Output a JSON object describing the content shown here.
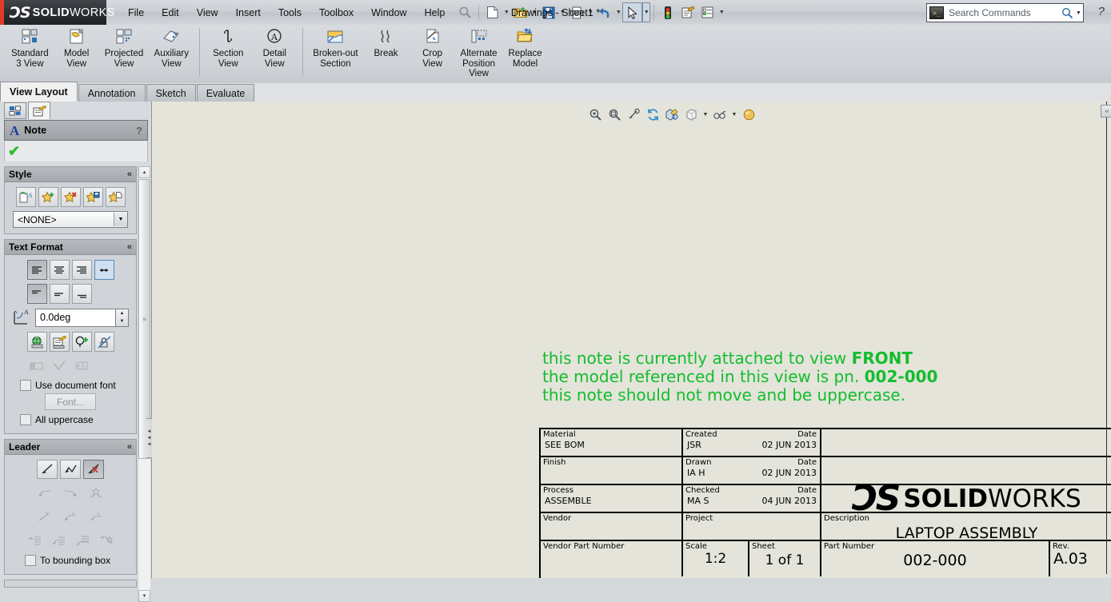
{
  "app": {
    "brand_ds": "ƆS",
    "brand_solid": "SOLID",
    "brand_works": "WORKS",
    "document_title": "Drawings - Sheet1 *",
    "help_glyph": "?"
  },
  "menubar": {
    "items": [
      "File",
      "Edit",
      "View",
      "Insert",
      "Tools",
      "Toolbox",
      "Window",
      "Help"
    ]
  },
  "quick_toolbar": {
    "items": [
      {
        "name": "swift-search-icon",
        "glyph": "⌕"
      },
      {
        "name": "new-document-icon",
        "glyph": ""
      },
      {
        "name": "open-document-icon",
        "glyph": ""
      },
      {
        "name": "save-icon",
        "glyph": ""
      },
      {
        "name": "print-icon",
        "glyph": ""
      },
      {
        "name": "undo-icon",
        "glyph": ""
      },
      {
        "name": "select-arrow-icon",
        "glyph": ""
      },
      {
        "name": "rebuild-traffic-light-icon",
        "glyph": ""
      },
      {
        "name": "file-properties-icon",
        "glyph": ""
      },
      {
        "name": "options-icon",
        "glyph": ""
      }
    ]
  },
  "search": {
    "placeholder": "Search Commands",
    "icon": "command-prompt-icon"
  },
  "ribbon": {
    "groups": [
      {
        "commands": [
          {
            "label_line1": "Standard",
            "label_line2": "3 View",
            "icon": "standard-3-view-icon"
          },
          {
            "label_line1": "Model",
            "label_line2": "View",
            "icon": "model-view-icon"
          },
          {
            "label_line1": "Projected",
            "label_line2": "View",
            "icon": "projected-view-icon"
          },
          {
            "label_line1": "Auxiliary",
            "label_line2": "View",
            "icon": "auxiliary-view-icon"
          }
        ]
      },
      {
        "commands": [
          {
            "label_line1": "Section",
            "label_line2": "View",
            "icon": "section-view-icon"
          },
          {
            "label_line1": "Detail",
            "label_line2": "View",
            "icon": "detail-view-icon"
          }
        ]
      },
      {
        "commands": [
          {
            "label_line1": "Broken-out",
            "label_line2": "Section",
            "icon": "broken-out-section-icon"
          },
          {
            "label_line1": "Break",
            "label_line2": "",
            "icon": "break-icon"
          },
          {
            "label_line1": "Crop",
            "label_line2": "View",
            "icon": "crop-view-icon"
          },
          {
            "label_line1": "Alternate",
            "label_line2": "Position",
            "label_line3": "View",
            "icon": "alternate-position-view-icon"
          },
          {
            "label_line1": "Replace",
            "label_line2": "Model",
            "icon": "replace-model-icon"
          }
        ]
      }
    ]
  },
  "tabs": [
    {
      "label": "View Layout",
      "active": true
    },
    {
      "label": "Annotation",
      "active": false
    },
    {
      "label": "Sketch",
      "active": false
    },
    {
      "label": "Evaluate",
      "active": false
    }
  ],
  "property_manager": {
    "tabs": [
      {
        "name": "feature-manager-tab",
        "active": false
      },
      {
        "name": "property-manager-tab",
        "active": true
      }
    ],
    "header": {
      "icon": "note-A-icon",
      "title": "Note",
      "help": "?"
    },
    "ok_check": "✔",
    "groups": [
      {
        "name": "style",
        "title": "Style",
        "collapse_glyph": "«",
        "buttons": [
          {
            "name": "apply-style-icon"
          },
          {
            "name": "add-new-style-icon"
          },
          {
            "name": "delete-style-icon"
          },
          {
            "name": "save-style-icon"
          },
          {
            "name": "load-style-icon"
          }
        ],
        "dropdown_value": "<NONE>"
      },
      {
        "name": "text-format",
        "title": "Text Format",
        "collapse_glyph": "«",
        "align_buttons": [
          {
            "name": "align-left-icon",
            "state": "down"
          },
          {
            "name": "align-center-icon",
            "state": "normal"
          },
          {
            "name": "align-right-icon",
            "state": "normal"
          },
          {
            "name": "align-justify-width-icon",
            "state": "selected"
          }
        ],
        "valign_buttons": [
          {
            "name": "align-top-icon",
            "state": "down"
          },
          {
            "name": "align-middle-icon",
            "state": "normal"
          },
          {
            "name": "align-bottom-icon",
            "state": "normal"
          }
        ],
        "angle_value": "0.0deg",
        "tool_buttons": [
          {
            "name": "insert-hyperlink-icon",
            "state": "normal"
          },
          {
            "name": "link-to-property-icon",
            "state": "normal"
          },
          {
            "name": "add-symbol-icon",
            "state": "normal"
          },
          {
            "name": "lock-unlock-note-icon",
            "state": "normal"
          }
        ],
        "tool_buttons2": [
          {
            "name": "insert-geometric-tolerance-icon",
            "state": "disabled"
          },
          {
            "name": "insert-surface-finish-symbol-icon",
            "state": "disabled"
          },
          {
            "name": "insert-datum-feature-icon",
            "state": "disabled"
          }
        ],
        "use_document_font": {
          "label": "Use document font",
          "checked": false
        },
        "font_button": "Font...",
        "all_uppercase": {
          "label": "All uppercase",
          "checked": false
        }
      },
      {
        "name": "leader",
        "title": "Leader",
        "collapse_glyph": "«",
        "leader_buttons": [
          {
            "name": "leader-straight-icon",
            "state": "normal"
          },
          {
            "name": "leader-bent-icon",
            "state": "normal"
          },
          {
            "name": "no-leader-icon",
            "state": "down"
          }
        ],
        "arrow_rows": [
          [
            {
              "name": "leader-left-icon"
            },
            {
              "name": "leader-right-icon"
            },
            {
              "name": "multi-jog-leader-icon"
            }
          ],
          [
            {
              "name": "leader-x-left-icon"
            },
            {
              "name": "leader-x-bent-icon"
            },
            {
              "name": "leader-x-underline-icon"
            }
          ],
          [
            {
              "name": "leader-text-left-icon"
            },
            {
              "name": "leader-text-bent-icon"
            },
            {
              "name": "leader-text-underline-icon"
            },
            {
              "name": "leader-text-jog-icon"
            }
          ]
        ],
        "to_bounding_box": {
          "label": "To bounding box",
          "checked": false
        }
      }
    ],
    "scrollbar": {
      "up_glyph": "▲",
      "down_glyph": "▼",
      "grip": "≡"
    }
  },
  "canvas": {
    "view_toolbar": [
      {
        "name": "zoom-to-fit-icon"
      },
      {
        "name": "zoom-to-area-icon"
      },
      {
        "name": "previous-view-icon"
      },
      {
        "name": "rebuild-icon"
      },
      {
        "name": "view-orientation-icon"
      },
      {
        "name": "display-style-icon"
      },
      {
        "name": "hide-show-items-icon"
      },
      {
        "name": "apply-scene-icon"
      }
    ],
    "note": {
      "line1_plain": "this note is currently attached to view ",
      "line1_bold": "FRONT",
      "line2_plain": "the model referenced in this view is pn. ",
      "line2_bold": "002-000",
      "line3_plain": "this note should not move and be uppercase.",
      "color": "#13bd2e"
    },
    "edge_collapse_button": "‹‹"
  },
  "title_block": {
    "rows": [
      {
        "cells": [
          {
            "label": "Material",
            "value": "SEE BOM"
          },
          {
            "label": "Created",
            "label_right": "Date",
            "value": "JSR",
            "value_right": "02 JUN 2013"
          }
        ]
      },
      {
        "cells": [
          {
            "label": "Finish",
            "value": ""
          },
          {
            "label": "Drawn",
            "label_right": "Date",
            "value": "IA H",
            "value_right": "02 JUN 2013"
          }
        ]
      },
      {
        "cells": [
          {
            "label": "Process",
            "value": "ASSEMBLE"
          },
          {
            "label": "Checked",
            "label_right": "Date",
            "value": "MA S",
            "value_right": "04 JUN 2013"
          }
        ]
      },
      {
        "cells": [
          {
            "label": "Vendor",
            "value": ""
          },
          {
            "label": "Project",
            "value": ""
          }
        ]
      },
      {
        "cells": [
          {
            "label": "Vendor Part Number",
            "value": ""
          },
          {
            "label": "Scale",
            "value": "1:2"
          },
          {
            "label": "Sheet",
            "value": "1 of 1"
          }
        ]
      }
    ],
    "logo": {
      "mark": "ƆS",
      "bold_word": "SOLID",
      "light_word": "WORKS"
    },
    "description": {
      "label": "Description",
      "value": "LAPTOP ASSEMBLY"
    },
    "part_number": {
      "label": "Part Number",
      "value": "002-000"
    },
    "revision": {
      "label": "Rev.",
      "value": "A.03"
    }
  },
  "colors": {
    "canvas_bg": "#e4e4da",
    "note_green": "#13bd2e",
    "brand_red": "#e03a28",
    "chrome": "#d7dade"
  }
}
